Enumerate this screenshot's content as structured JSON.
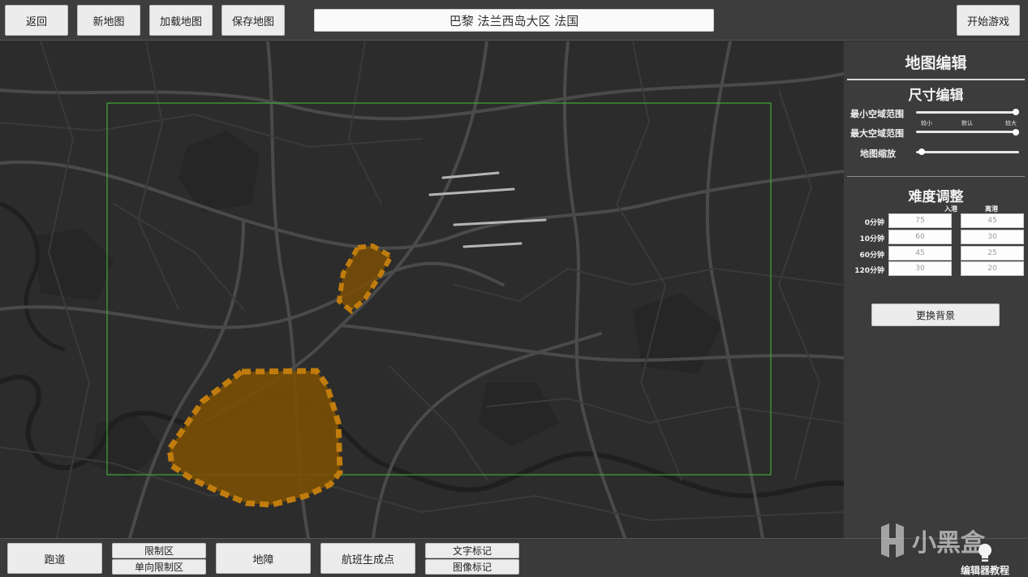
{
  "topbar": {
    "back_label": "返回",
    "new_map_label": "新地图",
    "load_map_label": "加载地图",
    "save_map_label": "保存地图",
    "map_title": "巴黎 法兰西岛大区 法国",
    "start_game_label": "开始游戏"
  },
  "panel": {
    "title": "地图编辑",
    "size_section_title": "尺寸编辑",
    "min_airspace_label": "最小空域范围",
    "max_airspace_label": "最大空域范围",
    "map_zoom_label": "地图缩放",
    "slider_ticks": [
      "较小",
      "默认",
      "较大"
    ],
    "sliders": {
      "min_airspace": 1.0,
      "max_airspace": 1.0,
      "map_zoom": 0.0
    },
    "difficulty_section_title": "难度调整",
    "col_arrival": "入港",
    "col_departure": "离港",
    "difficulty_rows": [
      {
        "label": "0分钟",
        "arrival": "75",
        "departure": "45"
      },
      {
        "label": "10分钟",
        "arrival": "60",
        "departure": "30"
      },
      {
        "label": "60分钟",
        "arrival": "45",
        "departure": "25"
      },
      {
        "label": "120分钟",
        "arrival": "30",
        "departure": "20"
      }
    ],
    "change_background_label": "更换背景"
  },
  "bottombar": {
    "runway_label": "跑道",
    "restricted_area_label": "限制区",
    "oneway_restricted_label": "单向限制区",
    "terrain_label": "地障",
    "spawn_point_label": "航班生成点",
    "text_marker_label": "文字标记",
    "image_marker_label": "图像标记",
    "tutorial_label": "编辑器教程"
  },
  "watermark": {
    "text": "小黑盒"
  },
  "colors": {
    "accent_orange": "#b8750a",
    "airspace_green": "#3fa83a",
    "panel_bg": "#3c3c3c"
  }
}
